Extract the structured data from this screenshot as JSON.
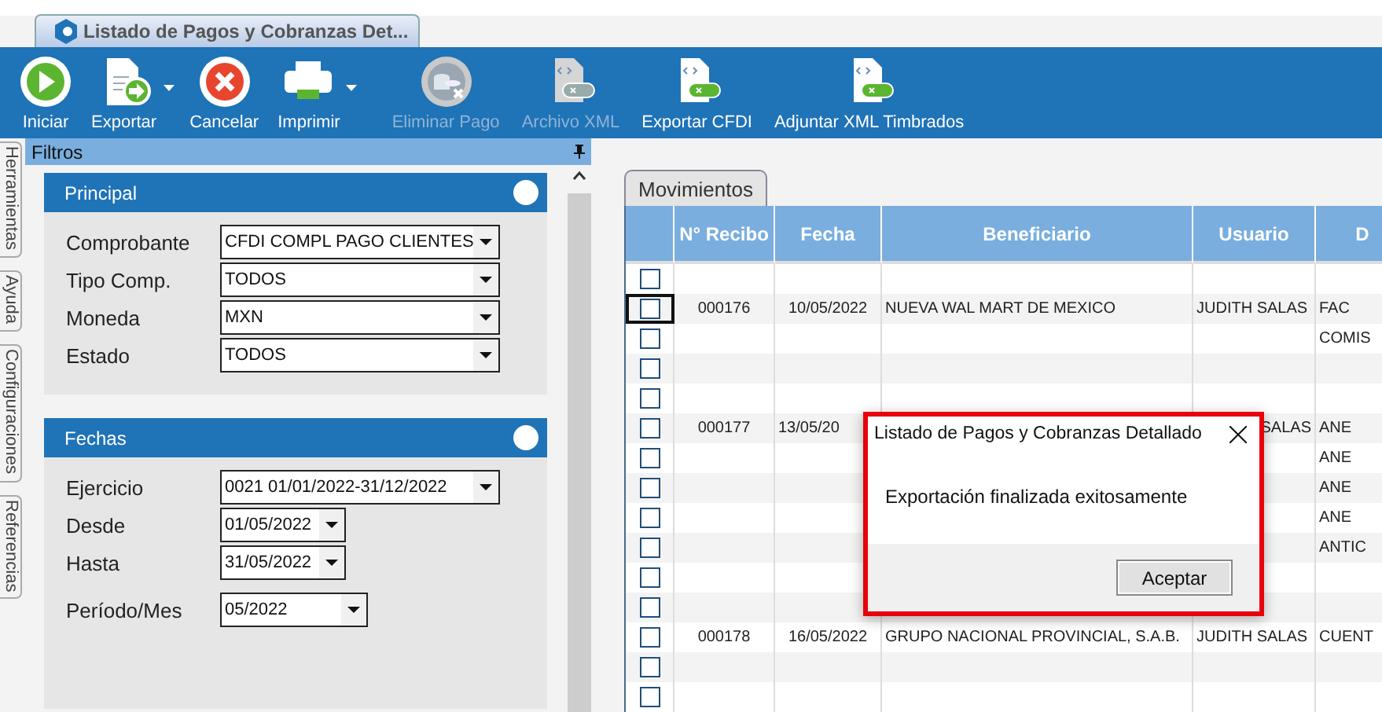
{
  "document_tab": {
    "title": "Listado de Pagos y Cobranzas Det...",
    "selected": true
  },
  "toolbar": [
    {
      "kind": "play",
      "label": "Iniciar",
      "dropdown": false,
      "disabled": false
    },
    {
      "kind": "export",
      "label": "Exportar",
      "dropdown": true,
      "disabled": false
    },
    {
      "kind": "cancel",
      "label": "Cancelar",
      "dropdown": false,
      "disabled": false
    },
    {
      "kind": "print",
      "label": "Imprimir",
      "dropdown": true,
      "disabled": false
    },
    {
      "kind": "database",
      "label": "Eliminar Pago",
      "dropdown": false,
      "disabled": true
    },
    {
      "kind": "xml",
      "label": "Archivo XML",
      "dropdown": false,
      "disabled": true
    },
    {
      "kind": "xml",
      "label": "Exportar CFDI",
      "dropdown": false,
      "disabled": false
    },
    {
      "kind": "xml",
      "label": "Adjuntar XML Timbrados",
      "dropdown": false,
      "disabled": false
    }
  ],
  "side_tabs": [
    "Herramientas",
    "Ayuda",
    "Configuraciones",
    "Referencias"
  ],
  "filters": {
    "title": "Filtros",
    "groups": [
      {
        "title": "Principal",
        "fields": [
          {
            "label": "Comprobante",
            "value": "CFDI COMPL PAGO CLIENTES",
            "kind": "select"
          },
          {
            "label": "Tipo Comp.",
            "value": "TODOS",
            "kind": "select"
          },
          {
            "label": "Moneda",
            "value": "MXN",
            "kind": "select"
          },
          {
            "label": "Estado",
            "value": "TODOS",
            "kind": "select"
          }
        ]
      },
      {
        "title": "Fechas",
        "fields": [
          {
            "label": "Ejercicio",
            "value": "0021 01/01/2022-31/12/2022",
            "kind": "select"
          },
          {
            "label": "Desde",
            "value": "01/05/2022",
            "kind": "date"
          },
          {
            "label": "Hasta",
            "value": "31/05/2022",
            "kind": "date"
          },
          {
            "label": "Período/Mes",
            "value": "05/2022",
            "kind": "month"
          }
        ]
      }
    ]
  },
  "movements": {
    "tab": {
      "label": "Movimientos",
      "selected": true
    },
    "columns": [
      "N° Recibo",
      "Fecha",
      "Beneficiario",
      "Usuario",
      "D"
    ],
    "rows": [
      {
        "checked": false,
        "focused": false,
        "cells": [
          "",
          "",
          "",
          "",
          ""
        ]
      },
      {
        "checked": false,
        "focused": true,
        "cells": [
          "000176",
          "10/05/2022",
          "NUEVA WAL MART DE MEXICO",
          "JUDITH SALAS",
          "FAC"
        ]
      },
      {
        "checked": false,
        "focused": false,
        "cells": [
          "",
          "",
          "",
          "",
          "COMIS"
        ]
      },
      {
        "checked": false,
        "focused": false,
        "cells": [
          "",
          "",
          "",
          "",
          ""
        ]
      },
      {
        "checked": false,
        "focused": false,
        "cells": [
          "",
          "",
          "",
          "",
          ""
        ]
      },
      {
        "checked": false,
        "focused": false,
        "covered": true,
        "cells": [
          "000177",
          "13/05/20",
          "",
          "SALAS",
          "ANE"
        ]
      },
      {
        "checked": false,
        "focused": false,
        "cells": [
          "",
          "",
          "",
          "",
          "ANE"
        ]
      },
      {
        "checked": false,
        "focused": false,
        "cells": [
          "",
          "",
          "",
          "",
          "ANE"
        ]
      },
      {
        "checked": false,
        "focused": false,
        "cells": [
          "",
          "",
          "",
          "",
          "ANE"
        ]
      },
      {
        "checked": false,
        "focused": false,
        "cells": [
          "",
          "",
          "",
          "",
          "ANTIC"
        ]
      },
      {
        "checked": false,
        "focused": false,
        "cells": [
          "",
          "",
          "",
          "",
          ""
        ]
      },
      {
        "checked": false,
        "focused": false,
        "cells": [
          "",
          "",
          "",
          "",
          ""
        ]
      },
      {
        "checked": false,
        "focused": false,
        "cells": [
          "000178",
          "16/05/2022",
          "GRUPO NACIONAL PROVINCIAL, S.A.B.",
          "JUDITH SALAS",
          "CUENT"
        ]
      },
      {
        "checked": false,
        "focused": false,
        "cells": [
          "",
          "",
          "",
          "",
          ""
        ]
      },
      {
        "checked": false,
        "focused": false,
        "cells": [
          "",
          "",
          "",
          "",
          ""
        ]
      }
    ]
  },
  "dialog": {
    "title": "Listado de Pagos y Cobranzas Detallado",
    "message": "Exportación finalizada exitosamente",
    "button": "Aceptar"
  }
}
